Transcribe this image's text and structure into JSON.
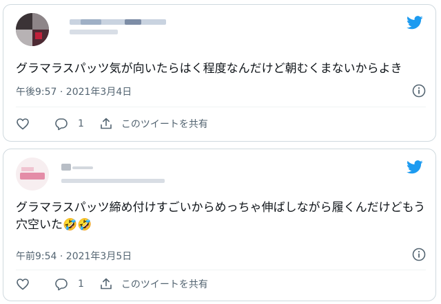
{
  "tweets": [
    {
      "text": "グラマラスパッツ気が向いたらはく程度なんだけど朝むくまないからよき",
      "timestamp": "午後9:57 · 2021年3月4日",
      "reply_count": "1",
      "share_label": "このツイートを共有"
    },
    {
      "text": "グラマラスパッツ締め付けすごいからめっちゃ伸ばしながら履くんだけどもう穴空いた",
      "emojis": "🤣🤣",
      "timestamp": "午前9:54 · 2021年3月5日",
      "reply_count": "1",
      "share_label": "このツイートを共有"
    }
  ],
  "colors": {
    "twitter_blue": "#1d9bf0",
    "secondary_text": "#536471",
    "border": "#cfd9de"
  },
  "icons": {
    "logo": "twitter-bird-icon",
    "info": "info-circle-icon",
    "like": "heart-icon",
    "reply": "speech-bubble-icon",
    "share": "share-upload-icon"
  }
}
